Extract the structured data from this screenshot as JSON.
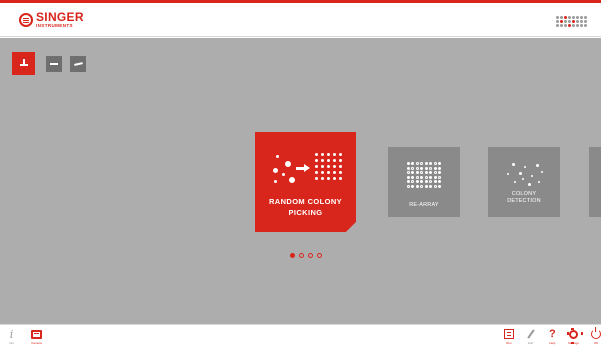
{
  "header": {
    "brand_name": "SINGER",
    "brand_sub": "INSTRUMENTS"
  },
  "mode_buttons": [
    {
      "icon": "colony-pick-icon",
      "active": true
    },
    {
      "icon": "plate-icon",
      "active": false
    },
    {
      "icon": "wrench-icon",
      "active": false
    }
  ],
  "cards": [
    {
      "label": "RANDOM COLONY\nPICKING",
      "icon": "random-colony-picking-icon",
      "selected": true
    },
    {
      "label": "RE-ARRAY",
      "icon": "re-array-icon",
      "selected": false
    },
    {
      "label": "COLONY\nDETECTION",
      "icon": "colony-detection-icon",
      "selected": false
    }
  ],
  "pager": {
    "count": 4,
    "current": 1
  },
  "footer": {
    "left": [
      {
        "label": "Info",
        "icon": "info-icon"
      },
      {
        "label": "Camera",
        "icon": "camera-screen-icon"
      }
    ],
    "right": [
      {
        "label": "Run",
        "icon": "run-icon"
      },
      {
        "label": "Edit",
        "icon": "edit-icon"
      },
      {
        "label": "Help",
        "icon": "help-icon"
      },
      {
        "label": "Settings",
        "icon": "settings-icon"
      },
      {
        "label": "Off",
        "icon": "power-icon"
      }
    ]
  },
  "colors": {
    "accent": "#d8261c",
    "background": "#adadad",
    "card": "#8a8a8a"
  }
}
